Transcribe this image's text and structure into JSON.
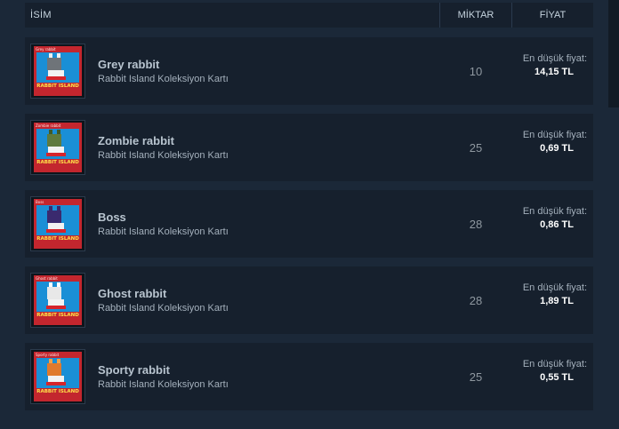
{
  "header": {
    "name": "İSİM",
    "quantity": "MİKTAR",
    "price": "FİYAT"
  },
  "items": [
    {
      "name": "Grey rabbit",
      "subtitle": "Rabbit Island Koleksiyon Kartı",
      "quantity": "10",
      "price_label": "En düşük fiyat:",
      "price": "14,15 TL",
      "card_label": "Grey rabbit",
      "card_logo": "RABBIT ISLAND",
      "head_color": "#6f7479",
      "ear_color": "#f0f0f0"
    },
    {
      "name": "Zombie rabbit",
      "subtitle": "Rabbit Island Koleksiyon Kartı",
      "quantity": "25",
      "price_label": "En düşük fiyat:",
      "price": "0,69 TL",
      "card_label": "Zombie rabbit",
      "card_logo": "RABBIT ISLAND",
      "head_color": "#5f7a3e",
      "ear_color": "#3f5a2a"
    },
    {
      "name": "Boss",
      "subtitle": "Rabbit Island Koleksiyon Kartı",
      "quantity": "28",
      "price_label": "En düşük fiyat:",
      "price": "0,86 TL",
      "card_label": "Boss",
      "card_logo": "RABBIT ISLAND",
      "head_color": "#3a2a6e",
      "ear_color": "#3a2a6e"
    },
    {
      "name": "Ghost rabbit",
      "subtitle": "Rabbit Island Koleksiyon Kartı",
      "quantity": "28",
      "price_label": "En düşük fiyat:",
      "price": "1,89 TL",
      "card_label": "Ghost rabbit",
      "card_logo": "RABBIT ISLAND",
      "head_color": "#e8e8e8",
      "ear_color": "#ffffff"
    },
    {
      "name": "Sporty rabbit",
      "subtitle": "Rabbit Island Koleksiyon Kartı",
      "quantity": "25",
      "price_label": "En düşük fiyat:",
      "price": "0,55 TL",
      "card_label": "Sporty rabbit",
      "card_logo": "RABBIT ISLAND",
      "head_color": "#e07a2c",
      "ear_color": "#f0a24a"
    }
  ]
}
